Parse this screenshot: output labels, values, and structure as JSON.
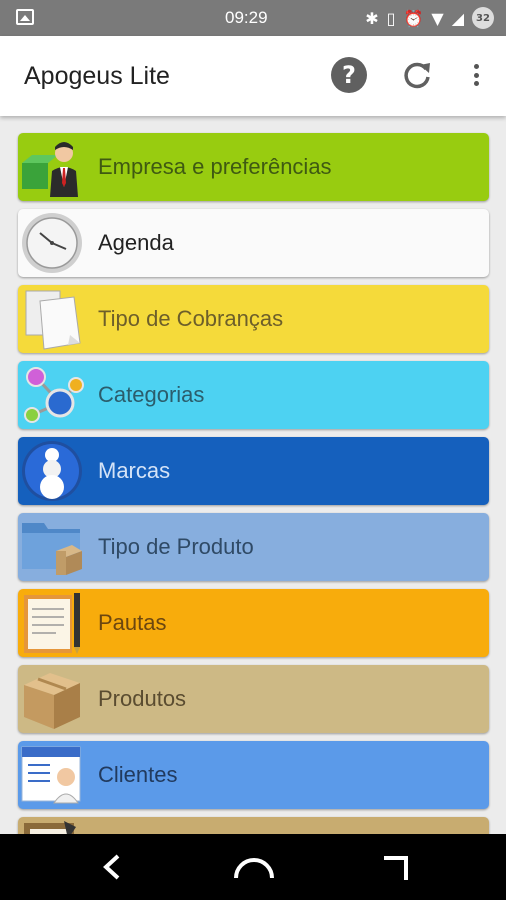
{
  "status_bar": {
    "time": "09:29",
    "battery": "32"
  },
  "app_bar": {
    "title": "Apogeus Lite"
  },
  "menu_items": [
    {
      "label": "Empresa e preferências",
      "bg": "#98cc10",
      "text_color": "#3f5a12",
      "icon": "businessman-icon"
    },
    {
      "label": "Agenda",
      "bg": "#fafafa",
      "text_color": "#222222",
      "icon": "clock-icon"
    },
    {
      "label": "Tipo de Cobranças",
      "bg": "#f5da3a",
      "text_color": "#6d5f2a",
      "icon": "documents-icon"
    },
    {
      "label": "Categorias",
      "bg": "#4dd2f2",
      "text_color": "#2b5d6c",
      "icon": "molecule-icon"
    },
    {
      "label": "Marcas",
      "bg": "#1560bd",
      "text_color": "#d4e3f7",
      "icon": "pawn-icon"
    },
    {
      "label": "Tipo de Produto",
      "bg": "#87aede",
      "text_color": "#2f4a66",
      "icon": "folder-box-icon"
    },
    {
      "label": "Pautas",
      "bg": "#f8ac0c",
      "text_color": "#6c4710",
      "icon": "notebook-pen-icon"
    },
    {
      "label": "Produtos",
      "bg": "#cdb985",
      "text_color": "#5a4c30",
      "icon": "box-icon"
    },
    {
      "label": "Clientes",
      "bg": "#5b9ae9",
      "text_color": "#213a5e",
      "icon": "client-card-icon"
    },
    {
      "label": "",
      "bg": "#c8ac70",
      "text_color": "#5a4c30",
      "icon": "clipboard-icon"
    }
  ]
}
